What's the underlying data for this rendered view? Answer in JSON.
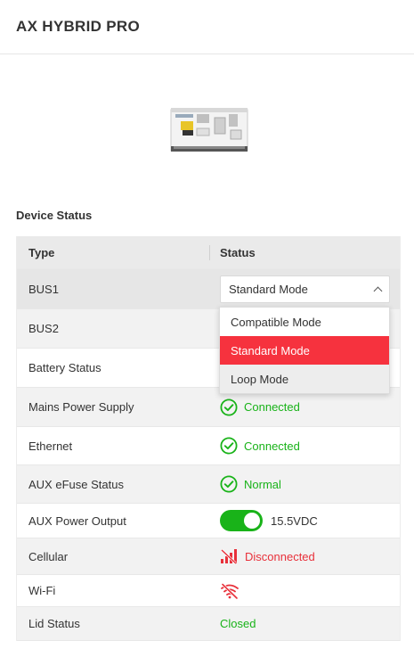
{
  "header": {
    "title": "AX HYBRID PRO"
  },
  "section": {
    "title": "Device Status"
  },
  "table": {
    "columns": [
      "Type",
      "Status"
    ],
    "rows": [
      {
        "type": "BUS1",
        "status": "Standard Mode",
        "kind": "select"
      },
      {
        "type": "BUS2",
        "status": "",
        "kind": "select"
      },
      {
        "type": "Battery Status",
        "status": "",
        "kind": "none"
      },
      {
        "type": "Mains Power Supply",
        "status": "Connected",
        "kind": "ok"
      },
      {
        "type": "Ethernet",
        "status": "Connected",
        "kind": "ok"
      },
      {
        "type": "AUX eFuse Status",
        "status": "Normal",
        "kind": "ok"
      },
      {
        "type": "AUX Power Output",
        "status": "15.5VDC",
        "kind": "toggle"
      },
      {
        "type": "Cellular",
        "status": "Disconnected",
        "kind": "bad"
      },
      {
        "type": "Wi-Fi",
        "status": "",
        "kind": "wifi-off"
      },
      {
        "type": "Lid Status",
        "status": "Closed",
        "kind": "plain-ok"
      }
    ]
  },
  "dropdown": {
    "options": [
      "Compatible Mode",
      "Standard Mode",
      "Loop Mode"
    ],
    "selected": "Standard Mode"
  },
  "colors": {
    "success": "#19b319",
    "danger": "#e8303a",
    "accent": "#f6323e"
  },
  "icons": {
    "ok": "check-circle-icon",
    "cellular": "signal-off-icon",
    "wifi": "wifi-off-icon",
    "chevron": "chevron-up-icon"
  }
}
